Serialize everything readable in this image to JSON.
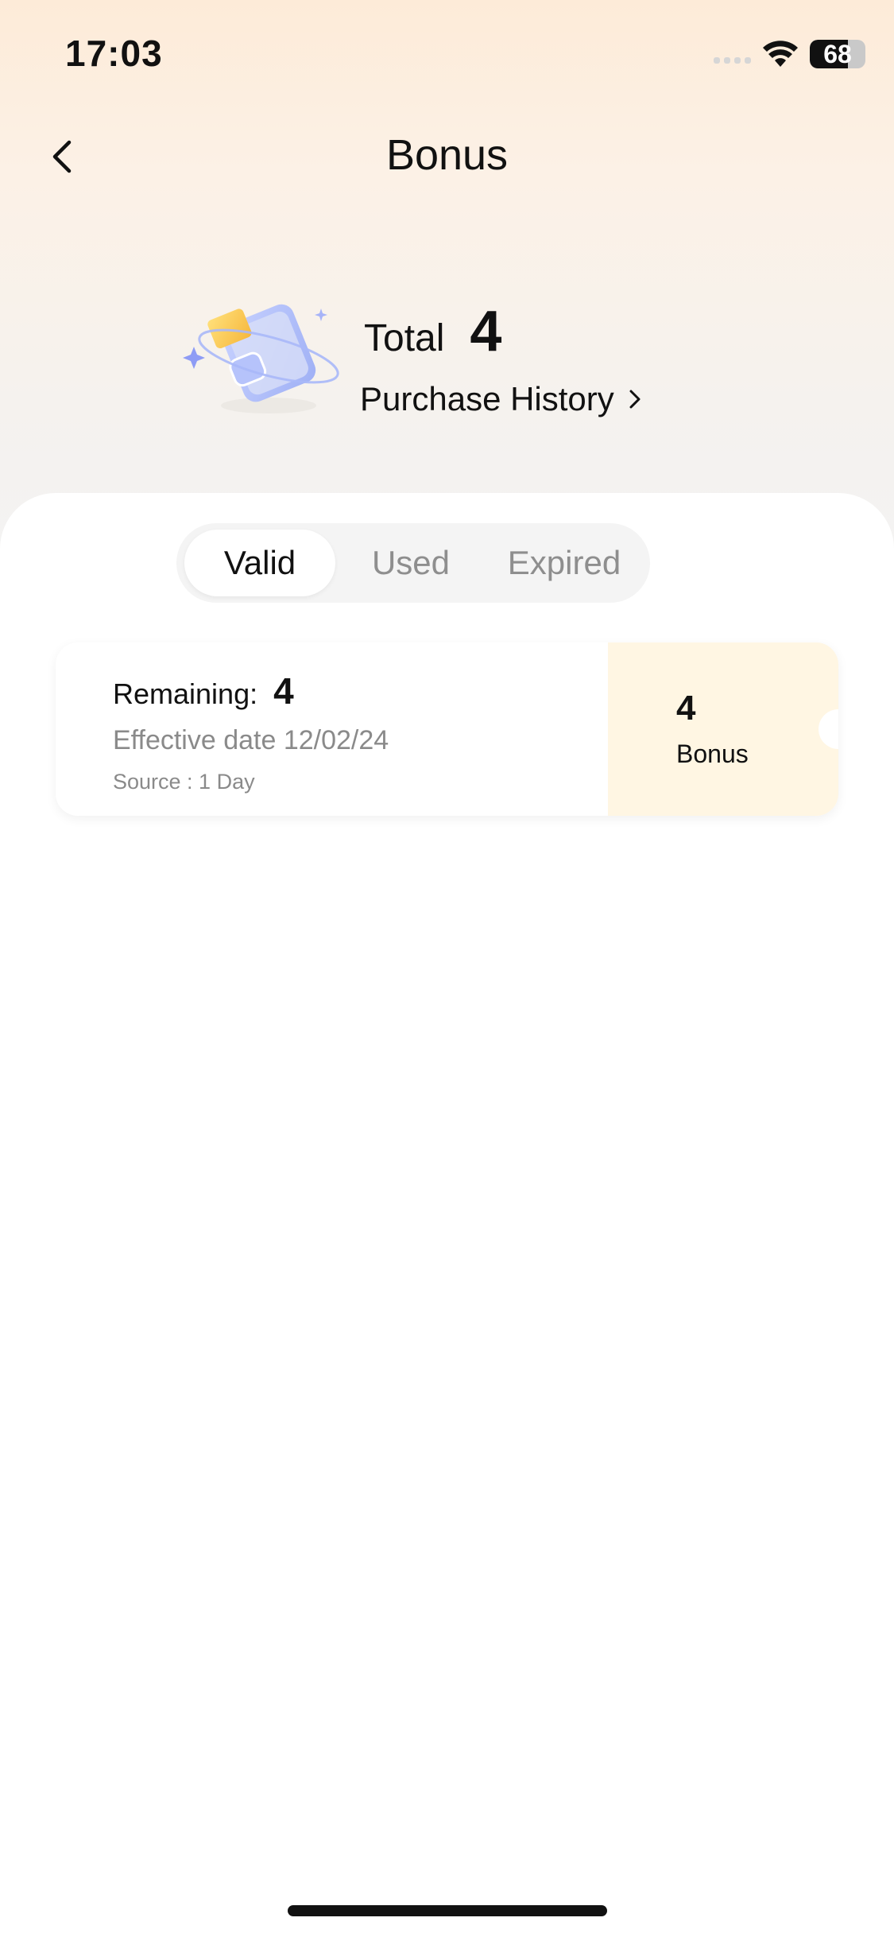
{
  "status_bar": {
    "time": "17:03",
    "battery": "68",
    "battery_level": 0.68,
    "icons": [
      "signal-icon",
      "wifi-icon",
      "battery-icon"
    ]
  },
  "header": {
    "title": "Bonus",
    "back_icon": "chevron-left-icon"
  },
  "summary": {
    "total_label": "Total",
    "total_value": "4",
    "purchase_history_label": "Purchase History",
    "illustration_icon": "wallet-icon",
    "chevron_icon": "chevron-right-icon"
  },
  "tabs": {
    "active_index": 0,
    "items": [
      {
        "label": "Valid"
      },
      {
        "label": "Used"
      },
      {
        "label": "Expired"
      }
    ]
  },
  "bonuses": [
    {
      "remaining_label": "Remaining:",
      "remaining_value": "4",
      "effective_date": "Effective date 12/02/24",
      "source": "Source : 1 Day",
      "bonus_value": "4",
      "bonus_label": "Bonus"
    }
  ],
  "colors": {
    "header_gradient_top": "#fdebd8",
    "coupon_accent": "#fff6e3",
    "text_primary": "#111111",
    "text_secondary": "#8a8a8a"
  }
}
